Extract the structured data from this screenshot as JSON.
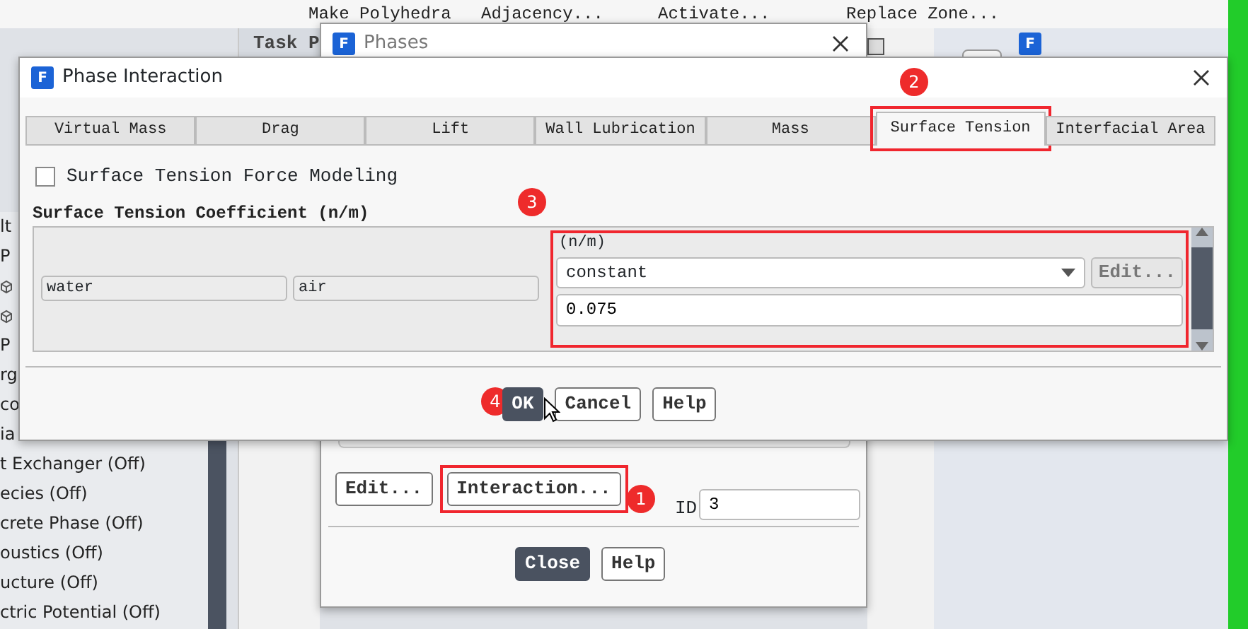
{
  "toolbar": {
    "items": [
      "Make Polyhedra",
      "Adjacency...",
      "Activate...",
      "Replace Zone..."
    ]
  },
  "tree": {
    "items": [
      {
        "kind": "text",
        "label": "lt"
      },
      {
        "kind": "text",
        "label": "P"
      },
      {
        "kind": "icon"
      },
      {
        "kind": "icon"
      },
      {
        "kind": "text",
        "label": "P"
      },
      {
        "kind": "text",
        "label": "rg"
      },
      {
        "kind": "text",
        "label": "co"
      },
      {
        "kind": "text",
        "label": "ia"
      },
      {
        "kind": "text",
        "label": "t Exchanger (Off)"
      },
      {
        "kind": "text",
        "label": "ecies (Off)"
      },
      {
        "kind": "text",
        "label": "crete Phase (Off)"
      },
      {
        "kind": "text",
        "label": "oustics (Off)"
      },
      {
        "kind": "text",
        "label": "ucture (Off)"
      },
      {
        "kind": "text",
        "label": "ctric Potential (Off)"
      }
    ]
  },
  "task_page": {
    "title": "Task P"
  },
  "phases_window": {
    "logo": "F",
    "title": "Phases",
    "buttons": [
      {
        "label": "Edit...",
        "highlighted": false
      },
      {
        "label": "Interaction...",
        "highlighted": true,
        "annotation": "1"
      }
    ],
    "id_label": "ID",
    "id_value": "3",
    "footer_buttons": [
      {
        "label": "Close",
        "primary": true
      },
      {
        "label": "Help",
        "primary": false
      }
    ]
  },
  "side_logo": "F",
  "dialog": {
    "logo": "F",
    "title": "Phase Interaction",
    "tabs": [
      {
        "label": "Virtual Mass",
        "selected": false
      },
      {
        "label": "Drag",
        "selected": false
      },
      {
        "label": "Lift",
        "selected": false
      },
      {
        "label": "Wall Lubrication",
        "selected": false
      },
      {
        "label": "Mass",
        "selected": false
      },
      {
        "label": "Surface Tension",
        "selected": true,
        "annotation": "2"
      },
      {
        "label": "Interfacial Area",
        "selected": false
      }
    ],
    "checkbox": {
      "label": "Surface Tension Force Modeling",
      "checked": false
    },
    "section_title": "Surface Tension Coefficient (n/m)",
    "table_annotation": "3",
    "rows": [
      {
        "phase_1": "water",
        "phase_2": "air",
        "unit": "(n/m)",
        "method": "constant",
        "edit_button": "Edit...",
        "value": "0.075"
      }
    ],
    "buttons": [
      {
        "label": "OK",
        "primary": true,
        "annotation": "4"
      },
      {
        "label": "Cancel",
        "primary": false
      },
      {
        "label": "Help",
        "primary": false
      }
    ]
  }
}
